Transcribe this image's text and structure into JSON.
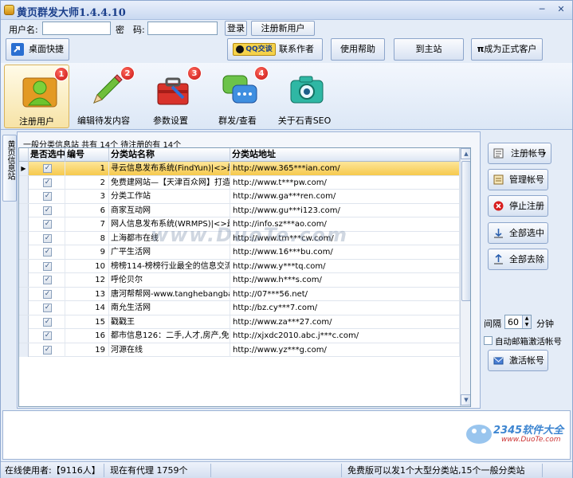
{
  "window": {
    "title": "黄页群发大师1.4.4.10",
    "minimize": "─",
    "close": "✕"
  },
  "login": {
    "username_label": "用户名:",
    "username_value": "",
    "password_label": "密　码:",
    "password_value": "",
    "login_button": "登录",
    "register_button": "注册新用户"
  },
  "toolbar": {
    "desktop_shortcut": "桌面快捷",
    "qq_badge": "QQ交谈",
    "contact_author": "联系作者",
    "help": "使用帮助",
    "main_site": "到主站",
    "become_customer": "成为正式客户"
  },
  "nav": {
    "items": [
      {
        "label": "注册用户",
        "badge": "1",
        "icon": "user-icon"
      },
      {
        "label": "编辑待发内容",
        "badge": "2",
        "icon": "pencil-icon"
      },
      {
        "label": "参数设置",
        "badge": "3",
        "icon": "toolbox-icon"
      },
      {
        "label": "群发/查看",
        "badge": "4",
        "icon": "chat-icon"
      },
      {
        "label": "关于石青SEO",
        "icon": "camera-icon"
      }
    ]
  },
  "side_tab": {
    "label": "黄页信息站"
  },
  "panel": {
    "caption": "一般分类信息站 共有 14个 待注册的有 14个",
    "columns": [
      "是否选中",
      "编号",
      "分类站名称",
      "分类站地址"
    ],
    "rows": [
      {
        "num": "1",
        "name": "寻云信息发布系统(FindYun)|<>最专",
        "url": "http://www.365***ian.com/"
      },
      {
        "num": "2",
        "name": "免费建网站—【天津百众网】打造",
        "url": "http://www.t***pw.com/"
      },
      {
        "num": "3",
        "name": "分类工作站",
        "url": "http://www.ga***ren.com/"
      },
      {
        "num": "6",
        "name": "商家互动网",
        "url": "http://www.gu***i123.com/"
      },
      {
        "num": "7",
        "name": "网人信息发布系统(WRMPS)|<>最专",
        "url": "http://info.sz***ao.com/"
      },
      {
        "num": "8",
        "name": "上海都市在线",
        "url": "http://www.tm***cw.com/"
      },
      {
        "num": "9",
        "name": "广平生活网",
        "url": "http://www.16***bu.com/"
      },
      {
        "num": "10",
        "name": "榜榜114-榜榜行业最全的信息交流",
        "url": "http://www.y***tq.com/"
      },
      {
        "num": "12",
        "name": "呼伦贝尔",
        "url": "http://www.h***s.com/"
      },
      {
        "num": "13",
        "name": "唐河帮帮网-www.tanghebangbang",
        "url": "http://07***56.net/"
      },
      {
        "num": "14",
        "name": "南允生活网",
        "url": "http://bz.cy***7.com/"
      },
      {
        "num": "15",
        "name": "戳戳王",
        "url": "http://www.za***27.com/"
      },
      {
        "num": "16",
        "name": "都市信息126：二手,人才,房产,免费",
        "url": "http://xjxdc2010.abc.j***c.com/"
      },
      {
        "num": "19",
        "name": "河源在线",
        "url": "http://www.yz***g.com/"
      }
    ],
    "checked_mark": "✓",
    "row_pointer": "▶"
  },
  "actions": {
    "register_account": "注册帐号",
    "manage_account": "管理帐号",
    "stop_register": "停止注册",
    "select_all": "全部选中",
    "deselect_all": "全部去除",
    "interval_label": "间隔",
    "interval_value": "60",
    "interval_unit": "分钟",
    "auto_activate": "自动邮箱激活帐号",
    "activate_account": "激活帐号"
  },
  "watermark": "www.DuoTe.com",
  "logo": {
    "text": "2345软件大全",
    "url_text": "www.DuoTe.com"
  },
  "status": {
    "online": "在线使用者:【9116人】",
    "proxies": "现在有代理 1759个",
    "version_note": "免费版可以发1个大型分类站,15个一般分类站"
  }
}
